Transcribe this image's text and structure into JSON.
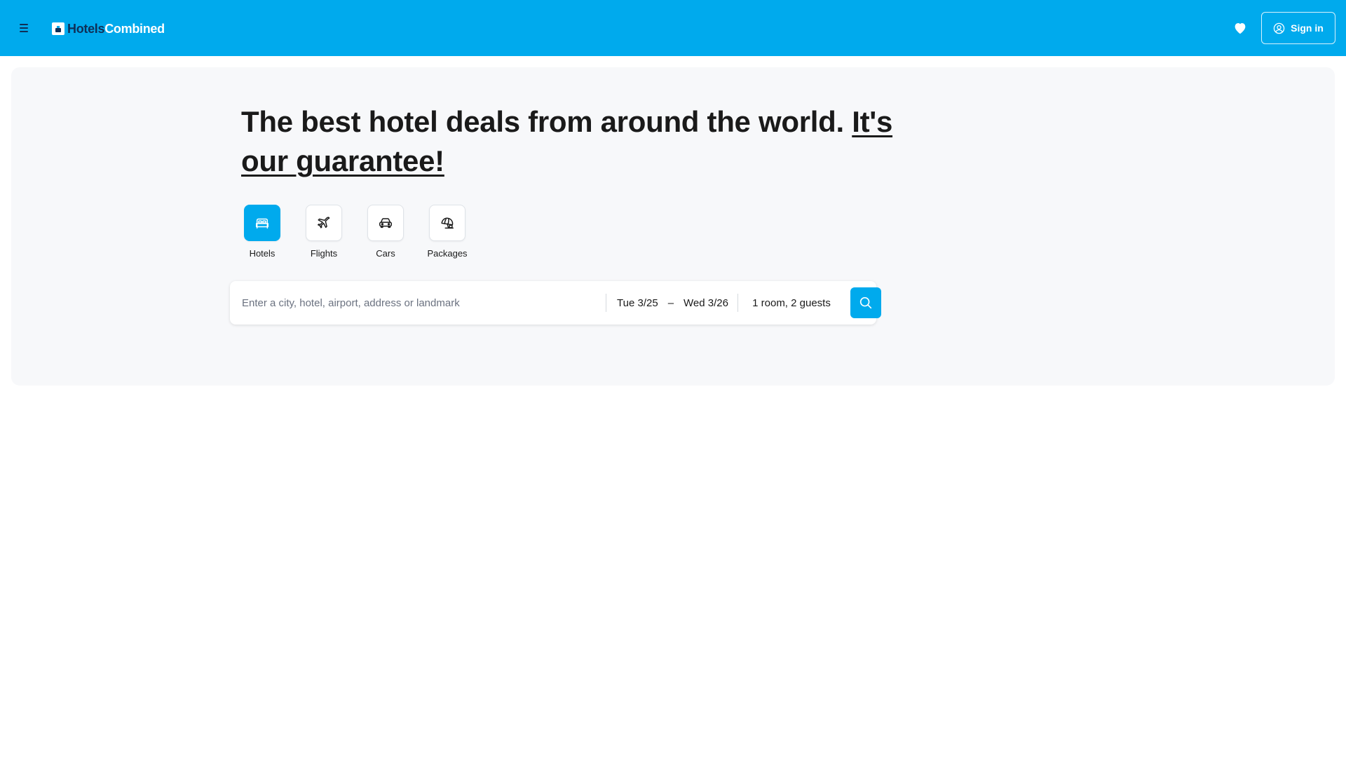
{
  "header": {
    "brand_part1": "Hotels",
    "brand_part2": "Combined",
    "signin_label": "Sign in",
    "icons": {
      "menu": "hamburger-icon",
      "favorites": "heart-icon",
      "user": "user-circle-icon"
    }
  },
  "hero": {
    "headline_text": "The best hotel deals from around the world. ",
    "headline_link": "It's our guarantee!"
  },
  "verticals": [
    {
      "label": "Hotels",
      "icon": "bed-icon",
      "active": true
    },
    {
      "label": "Flights",
      "icon": "plane-icon",
      "active": false
    },
    {
      "label": "Cars",
      "icon": "car-icon",
      "active": false
    },
    {
      "label": "Packages",
      "icon": "beach-umbrella-icon",
      "active": false
    }
  ],
  "search": {
    "placeholder": "Enter a city, hotel, airport, address or landmark",
    "checkin": "Tue 3/25",
    "date_separator": "–",
    "checkout": "Wed 3/26",
    "guests": "1 room, 2 guests",
    "search_icon": "search-icon"
  },
  "colors": {
    "brand_blue": "#00aaed",
    "brand_navy": "#0f2f57",
    "hero_bg": "#f7f8fa",
    "text": "#1a1a1a"
  }
}
